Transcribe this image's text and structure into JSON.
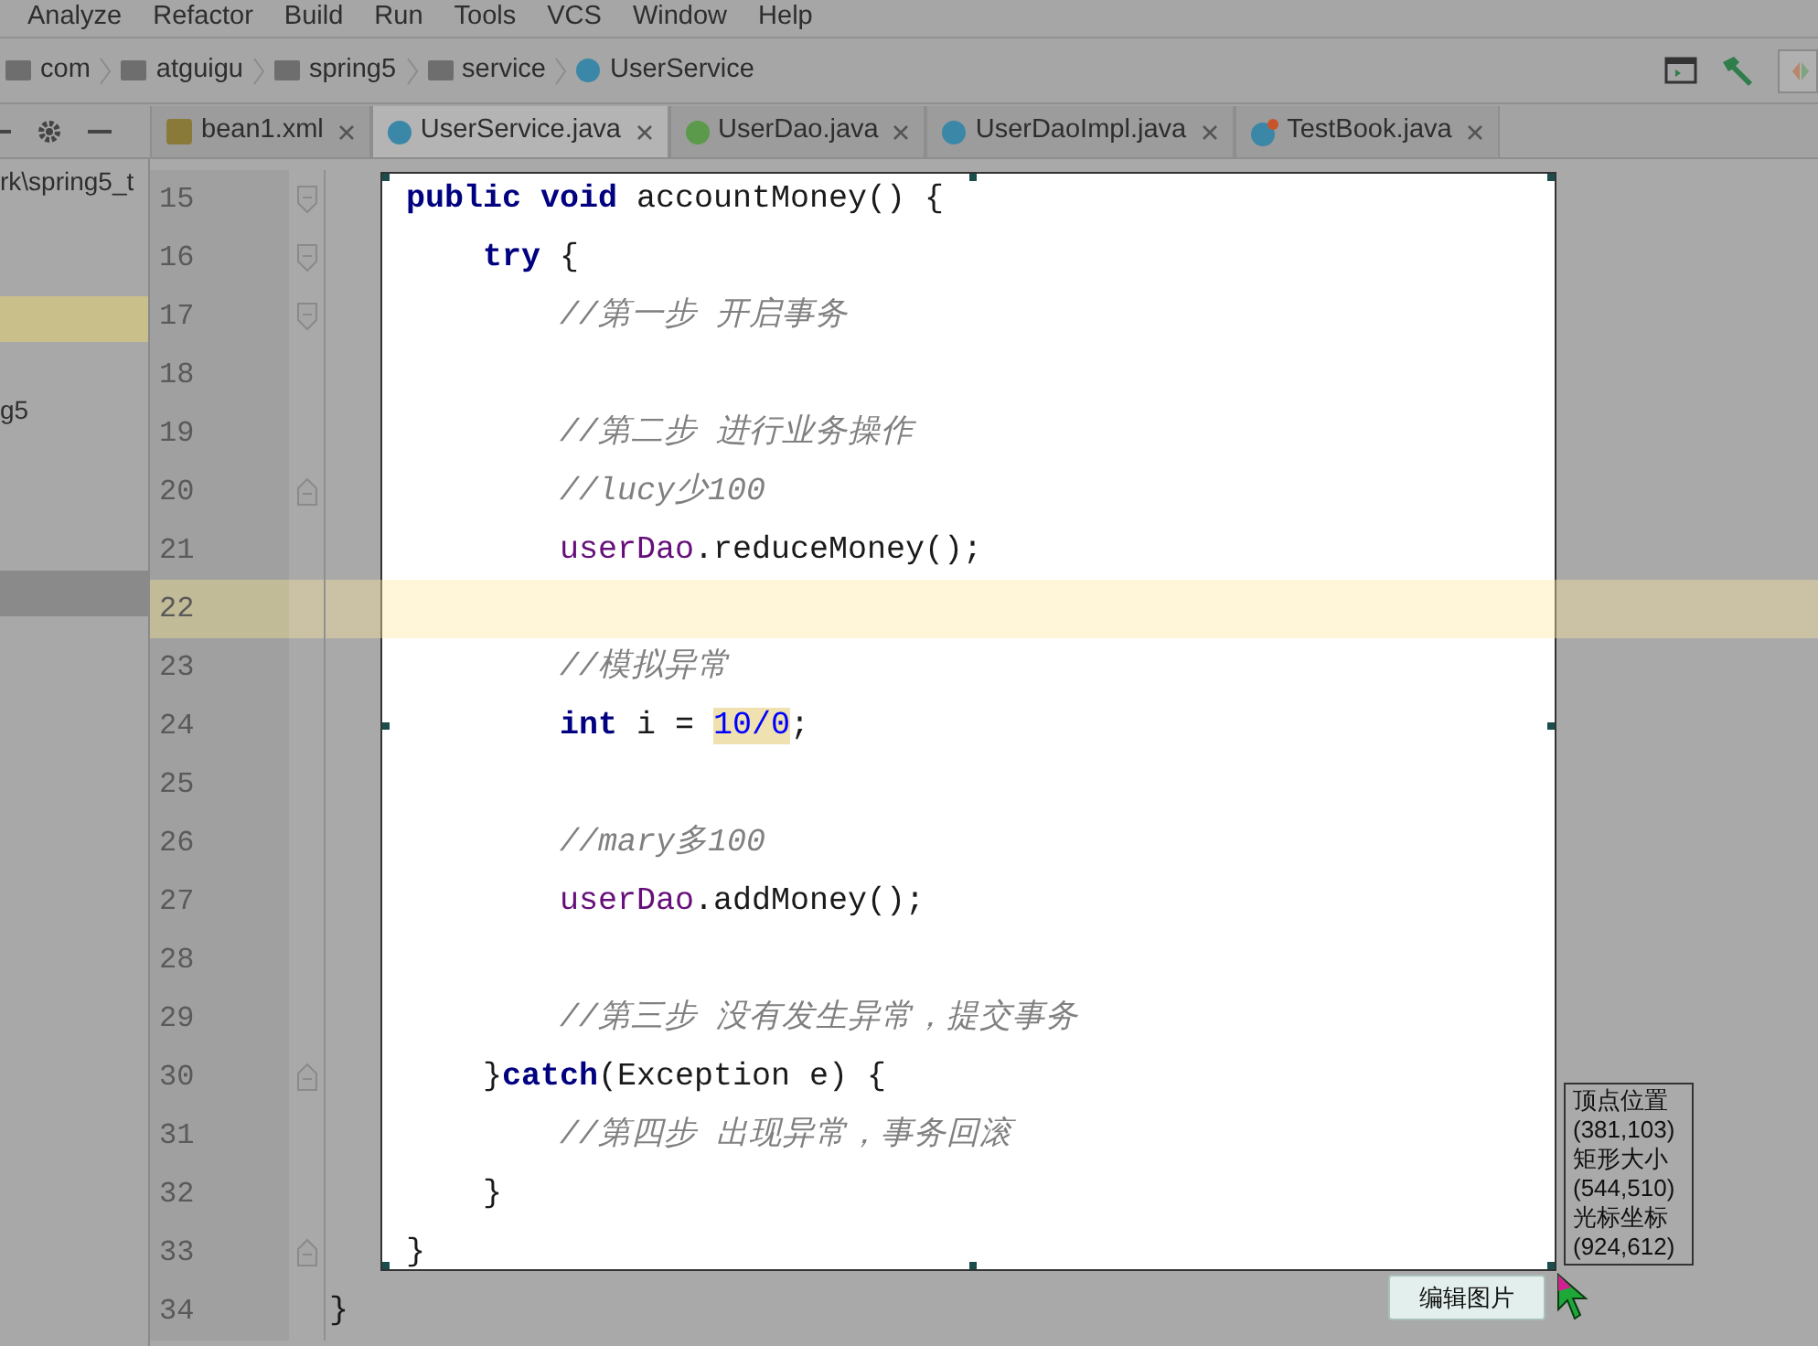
{
  "menu": [
    "Analyze",
    "Refactor",
    "Build",
    "Run",
    "Tools",
    "VCS",
    "Window",
    "Help"
  ],
  "breadcrumb": [
    {
      "label": "com",
      "kind": "folder"
    },
    {
      "label": "atguigu",
      "kind": "folder"
    },
    {
      "label": "spring5",
      "kind": "folder"
    },
    {
      "label": "service",
      "kind": "folder"
    },
    {
      "label": "UserService",
      "kind": "class"
    }
  ],
  "tabs": [
    {
      "label": "bean1.xml",
      "kind": "xml",
      "selected": false
    },
    {
      "label": "UserService.java",
      "kind": "class",
      "selected": true
    },
    {
      "label": "UserDao.java",
      "kind": "interface",
      "selected": false
    },
    {
      "label": "UserDaoImpl.java",
      "kind": "class",
      "selected": false
    },
    {
      "label": "TestBook.java",
      "kind": "test",
      "selected": false
    }
  ],
  "sidebar": {
    "rows": [
      {
        "label": "rk\\spring5_t",
        "selected": false,
        "current": false
      },
      {
        "selected": false,
        "current": false
      },
      {
        "selected": false,
        "current": false
      },
      {
        "selected": false,
        "current": true
      },
      {
        "selected": false,
        "current": false
      },
      {
        "label": "g5",
        "selected": false,
        "current": false
      },
      {
        "selected": false,
        "current": false
      },
      {
        "selected": false,
        "current": false
      },
      {
        "selected": false,
        "current": false
      },
      {
        "selected": true,
        "current": false
      }
    ]
  },
  "editor": {
    "lines": [
      {
        "number": "15",
        "kind": "member",
        "fold_start": true,
        "fold_end": false,
        "current": false,
        "tokens": [
          {
            "text": "public void",
            "kind": "keyword"
          },
          {
            "text": " accountMoney() {"
          }
        ]
      },
      {
        "number": "16",
        "kind": "block",
        "fold_start": true,
        "fold_end": false,
        "current": false,
        "tokens": [
          {
            "text": "try",
            "kind": "keyword"
          },
          {
            "text": " {"
          }
        ]
      },
      {
        "number": "17",
        "kind": "nested",
        "fold_start": true,
        "fold_end": false,
        "current": false,
        "tokens": [
          {
            "text": "//第一步 开启事务",
            "kind": "comment"
          }
        ]
      },
      {
        "number": "18",
        "fold_start": false,
        "fold_end": false,
        "current": false
      },
      {
        "number": "19",
        "kind": "nested",
        "fold_start": false,
        "fold_end": false,
        "current": false,
        "tokens": [
          {
            "text": "//第二步 进行业务操作",
            "kind": "comment"
          }
        ]
      },
      {
        "number": "20",
        "kind": "nested",
        "fold_start": false,
        "fold_end": true,
        "current": false,
        "tokens": [
          {
            "text": "//lucy少100",
            "kind": "comment"
          }
        ]
      },
      {
        "number": "21",
        "kind": "nested",
        "fold_start": false,
        "fold_end": false,
        "current": false,
        "tokens": [
          {
            "text": "userDao",
            "kind": "field"
          },
          {
            "text": ".reduceMoney();"
          }
        ]
      },
      {
        "number": "22",
        "fold_start": false,
        "fold_end": false,
        "current": true
      },
      {
        "number": "23",
        "kind": "nested",
        "fold_start": false,
        "fold_end": false,
        "current": false,
        "tokens": [
          {
            "text": "//模拟异常",
            "kind": "comment"
          }
        ]
      },
      {
        "number": "24",
        "kind": "nested",
        "fold_start": false,
        "fold_end": false,
        "current": false,
        "tokens": [
          {
            "text": "int",
            "kind": "keyword"
          },
          {
            "text": " i = "
          },
          {
            "text": "10/0",
            "kind": "highlight"
          },
          {
            "text": ";"
          }
        ]
      },
      {
        "number": "25",
        "fold_start": false,
        "fold_end": false,
        "current": false
      },
      {
        "number": "26",
        "kind": "nested",
        "fold_start": false,
        "fold_end": false,
        "current": false,
        "tokens": [
          {
            "text": "//mary多100",
            "kind": "comment"
          }
        ]
      },
      {
        "number": "27",
        "kind": "nested",
        "fold_start": false,
        "fold_end": false,
        "current": false,
        "tokens": [
          {
            "text": "userDao",
            "kind": "field"
          },
          {
            "text": ".addMoney();"
          }
        ]
      },
      {
        "number": "28",
        "fold_start": false,
        "fold_end": false,
        "current": false
      },
      {
        "number": "29",
        "kind": "nested",
        "fold_start": false,
        "fold_end": false,
        "current": false,
        "tokens": [
          {
            "text": "//第三步 没有发生异常，提交事务",
            "kind": "comment"
          }
        ]
      },
      {
        "number": "30",
        "kind": "block",
        "fold_start": false,
        "fold_end": true,
        "current": false,
        "tokens": [
          {
            "text": "}"
          },
          {
            "text": "catch",
            "kind": "keyword"
          },
          {
            "text": "(Exception e) {"
          }
        ]
      },
      {
        "number": "31",
        "kind": "nested",
        "fold_start": false,
        "fold_end": false,
        "current": false,
        "tokens": [
          {
            "text": "//第四步 出现异常，事务回滚",
            "kind": "comment"
          }
        ]
      },
      {
        "number": "32",
        "kind": "block",
        "fold_start": false,
        "fold_end": false,
        "current": false,
        "tokens": [
          {
            "text": "}"
          }
        ]
      },
      {
        "number": "33",
        "kind": "member",
        "fold_start": false,
        "fold_end": true,
        "current": false,
        "tokens": [
          {
            "text": "}"
          }
        ]
      },
      {
        "number": "34",
        "kind": "top",
        "fold_start": false,
        "fold_end": false,
        "current": false,
        "tokens": [
          {
            "text": "}"
          }
        ]
      }
    ]
  },
  "capture": {
    "info": [
      "顶点位置",
      "(381,103)",
      "矩形大小",
      "(544,510)",
      "光标坐标",
      "(924,612)"
    ],
    "edit_button": "编辑图片"
  }
}
